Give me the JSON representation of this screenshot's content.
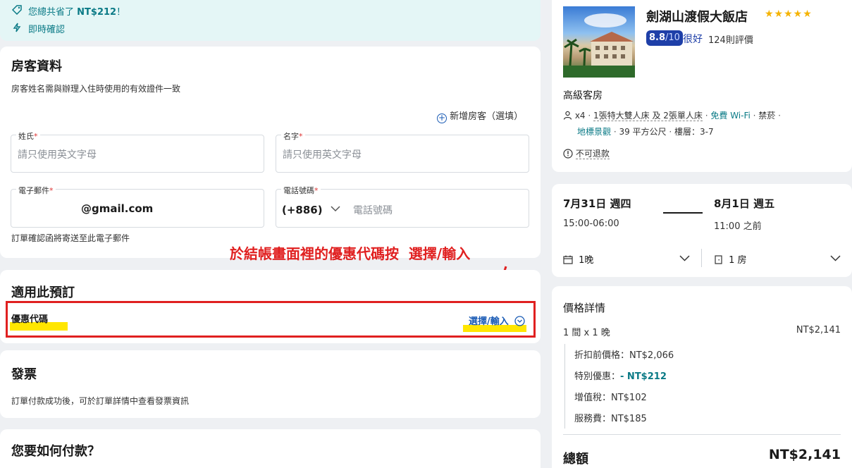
{
  "savings": {
    "text_prefix": "您總共省了",
    "amount": "NT$212",
    "suffix": "！",
    "instant": "即時確認"
  },
  "guest": {
    "title": "房客資料",
    "subtitle": "房客姓名需與辦理入住時使用的有效證件一致",
    "add_guest": "新增房客（選填）",
    "last_name_label": "姓氏",
    "last_name_placeholder": "請只使用英文字母",
    "first_name_label": "名字",
    "first_name_placeholder": "請只使用英文字母",
    "email_label": "電子郵件",
    "email_value": "@gmail.com",
    "phone_label": "電話號碼",
    "phone_code": "(+886)",
    "phone_placeholder": "電話號碼",
    "email_note": "訂單確認函將寄送至此電子郵件"
  },
  "annotation": {
    "text": "於結帳畫面裡的優惠代碼按  選擇/輸入"
  },
  "promo": {
    "title": "適用此預訂",
    "label": "優惠代碼",
    "action": "選擇/輸入"
  },
  "invoice": {
    "title": "發票",
    "text": "訂單付款成功後，可於訂單詳情中查看發票資訊"
  },
  "payment": {
    "title": "您要如何付款？"
  },
  "hotel": {
    "name": "劍湖山渡假大飯店",
    "stars": "★★★★★",
    "score": "8.8",
    "score_max": "/10",
    "rating_word": "很好",
    "reviews": "124則評價",
    "room_type": "高級客房",
    "guests": "x4",
    "beds": "1張特大雙人床 及 2張單人床",
    "wifi": "免費 Wi-Fi",
    "smoking": "禁菸",
    "view": "地標景觀",
    "size": "39 平方公尺",
    "floor": "樓層：3-7",
    "refund": "不可退款"
  },
  "dates": {
    "checkin_date": "7月31日 週四",
    "checkin_time": "15:00-06:00",
    "checkout_date": "8月1日 週五",
    "checkout_time": "11:00 之前",
    "nights": "1晚",
    "rooms": "1 房"
  },
  "price": {
    "title": "價格詳情",
    "line": "1 間 x 1 晚",
    "line_total": "NT$2,141",
    "original": "折扣前價格：NT$2,066",
    "discount_label": "特別優惠：",
    "discount_value": "- NT$212",
    "vat": "增值稅：NT$102",
    "service": "服務費：NT$185",
    "total_label": "總額",
    "total_value": "NT$2,141"
  },
  "colors": {
    "accent_red": "#e02020",
    "highlight": "#ffe600",
    "teal": "#0a7a86",
    "score_bg": "#1e3fa8"
  }
}
